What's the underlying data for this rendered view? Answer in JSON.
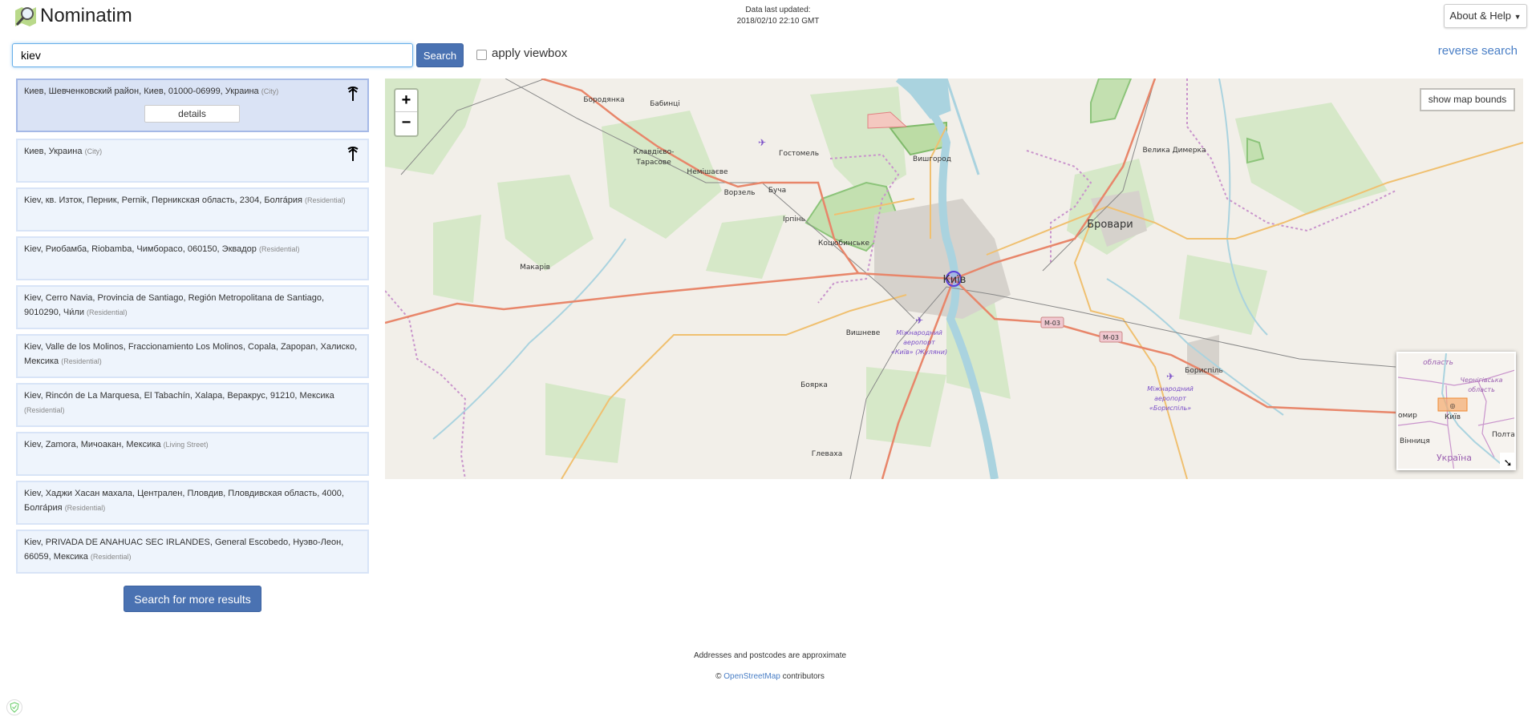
{
  "header": {
    "brand": "Nominatim",
    "data_updated_label": "Data last updated:",
    "data_updated_value": "2018/02/10 22:10 GMT",
    "about_label": "About & Help"
  },
  "search": {
    "query": "kiev",
    "button": "Search",
    "viewbox_label": "apply viewbox",
    "viewbox_checked": false,
    "reverse_label": "reverse search"
  },
  "results": [
    {
      "text": "Киев, Шевченковский район, Киев, 01000-06999, Украина",
      "type": "(City)",
      "icon": "city-icon",
      "selected": true
    },
    {
      "text": "Киев, Украина",
      "type": "(City)",
      "icon": "city-icon"
    },
    {
      "text": "Kiev, кв. Изток, Перник, Pernik, Перникская область, 2304, Болга́рия",
      "type": "(Residential)"
    },
    {
      "text": "Kiev, Риобамба, Riobamba, Чимборасо, 060150, Эквадор",
      "type": "(Residential)"
    },
    {
      "text": "Kiev, Cerro Navia, Provincia de Santiago, Región Metropolitana de Santiago, 9010290, Чи́ли",
      "type": "(Residential)"
    },
    {
      "text": "Kiev, Valle de los Molinos, Fraccionamiento Los Molinos, Copala, Zapopan, Халиско, Мексика",
      "type": "(Residential)"
    },
    {
      "text": "Kiev, Rincón de La Marquesa, El Tabachín, Xalapa, Веракрус, 91210, Мексика",
      "type": "(Residential)"
    },
    {
      "text": "Kiev, Zamora, Мичоакан, Мексика",
      "type": "(Living Street)"
    },
    {
      "text": "Kiev, Хаджи Хасан махала, Централен, Пловдив, Пловдивская область, 4000, Болга́рия",
      "type": "(Residential)"
    },
    {
      "text": "Kiev, PRIVADA DE ANAHUAC SEC IRLANDES, General Escobedo, Нуэво-Леон, 66059, Мексика",
      "type": "(Residential)"
    }
  ],
  "details_label": "details",
  "more_label": "Search for more results",
  "map": {
    "zoom_in": "+",
    "zoom_out": "−",
    "bounds_label": "show map bounds",
    "labels": {
      "borodianka": "Бородянка",
      "babyntsi": "Бабинці",
      "hostomel": "Гостомель",
      "klavdievo1": "Клавдієво-",
      "klavdievo2": "Тарасове",
      "nemishaeve": "Немішаєве",
      "vorzel": "Ворзель",
      "bucha": "Буча",
      "irpin": "Ірпінь",
      "kotsiubynske": "Коцюбинське",
      "makariv": "Макарів",
      "vyshhorod": "Вишгород",
      "vyshneve": "Вишневе",
      "boiarka": "Боярка",
      "hlevakha": "Глеваха",
      "kyiv": "Київ",
      "velyka_dymerka": "Велика Димерка",
      "brovary": "Бровари",
      "boryspil": "Бориспіль",
      "m03": "M-03",
      "zhuliany1": "Міжнародний",
      "zhuliany2": "аеропорт",
      "zhuliany3": "«Київ» (Жуляни)",
      "boryspil_ap1": "Міжнародний",
      "boryspil_ap2": "аеропорт",
      "boryspil_ap3": "«Бориспіль»"
    },
    "minimap": {
      "obl1": "область",
      "chernihiv1": "Чернігівська",
      "chernihiv2": "область",
      "zhytomyr": "омир",
      "kyiv": "Київ",
      "vinnytsia": "Вінниця",
      "poltava": "Полта",
      "ukraine": "Україна"
    },
    "colors": {
      "land": "#f2efe9",
      "forest": "#cfe5c0",
      "water": "#aad3df",
      "primary": "#e8866a",
      "secondary": "#f0c070",
      "boundary": "#c994cc"
    }
  },
  "footer": {
    "approx": "Addresses and postcodes are approximate",
    "copy": "©",
    "osm": "OpenStreetMap",
    "contributors": "contributors"
  }
}
